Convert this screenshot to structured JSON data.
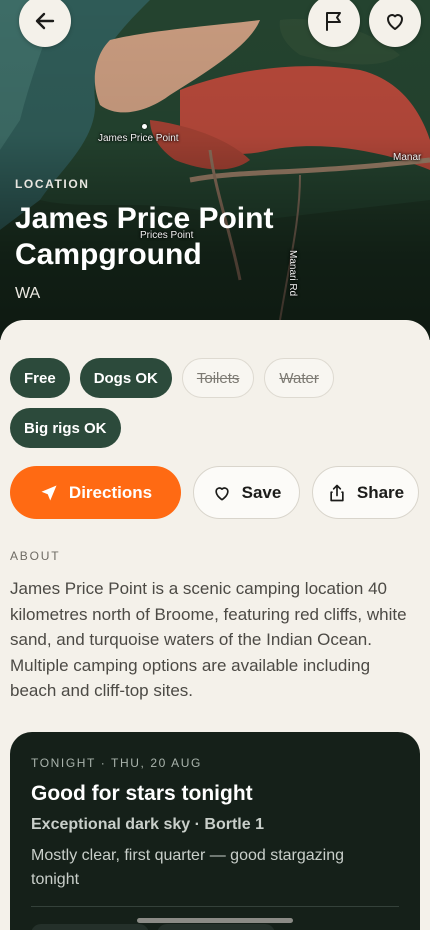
{
  "hero": {
    "eyebrow": "LOCATION",
    "title": "James Price Point Campground",
    "subtitle": "WA",
    "map_labels": {
      "point": "James Price Point",
      "area": "Prices Point",
      "road": "Manari Rd",
      "edge": "Manar"
    }
  },
  "buttons": {
    "back_icon": "arrow-left-icon",
    "report_icon": "flag-icon",
    "favorite_icon": "heart-icon"
  },
  "amenities": [
    {
      "label": "Free",
      "available": true
    },
    {
      "label": "Dogs OK",
      "available": true
    },
    {
      "label": "Toilets",
      "available": false
    },
    {
      "label": "Water",
      "available": false
    },
    {
      "label": "Big rigs OK",
      "available": true
    }
  ],
  "actions": {
    "directions": "Directions",
    "save": "Save",
    "share": "Share"
  },
  "about": {
    "label": "ABOUT",
    "text": "James Price Point is a scenic camping location 40 kilometres north of Broome, featuring red cliffs, white sand, and turquoise waters of the Indian Ocean. Multiple camping options are available including beach and cliff-top sites."
  },
  "tonight": {
    "eyebrow": "TONIGHT · THU, 20 AUG",
    "title": "Good for stars tonight",
    "subtitle": "Exceptional dark sky · Bortle 1",
    "description": "Mostly clear, first quarter — good stargazing tonight"
  },
  "colors": {
    "accent": "#ff6a13",
    "chip_on": "#2c4a3b",
    "card_bg": "#152019",
    "background": "#f4f1ea"
  }
}
